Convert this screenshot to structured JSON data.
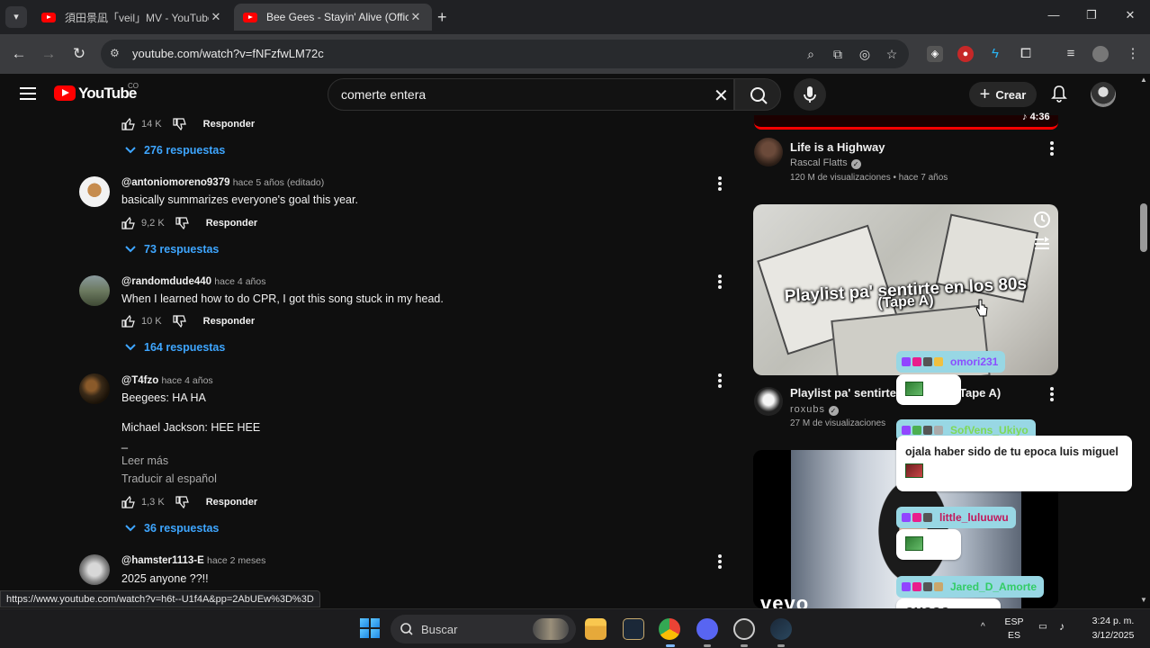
{
  "browser": {
    "tabs": [
      {
        "title": "須田景凪「veil」MV - YouTube",
        "active": false
      },
      {
        "title": "Bee Gees - Stayin' Alive (Official",
        "active": true
      }
    ],
    "url": "youtube.com/watch?v=fNFzfwLM72c",
    "status_link": "https://www.youtube.com/watch?v=h6t--U1f4A&pp=2AbUEw%3D%3D"
  },
  "youtube": {
    "logo_text": "YouTube",
    "country": "CO",
    "search_query": "comerte entera",
    "create_label": "Crear"
  },
  "comments": [
    {
      "likes": "14 K",
      "reply_label": "Responder",
      "replies": "276 respuestas"
    },
    {
      "author": "@antoniomoreno9379",
      "meta": "hace 5 años (editado)",
      "text": "basically summarizes everyone's goal this year.",
      "likes": "9,2 K",
      "reply_label": "Responder",
      "replies": "73 respuestas"
    },
    {
      "author": "@randomdude440",
      "meta": "hace 4 años",
      "text": "When I learned how to do CPR, I got this song stuck in my head.",
      "likes": "10 K",
      "reply_label": "Responder",
      "replies": "164 respuestas"
    },
    {
      "author": "@T4fzo",
      "meta": "hace 4 años",
      "lines": [
        "Beegees: HA HA",
        "Michael Jackson: HEE HEE",
        "_"
      ],
      "read_more": "Leer más",
      "translate": "Traducir al español",
      "likes": "1,3 K",
      "reply_label": "Responder",
      "replies": "36 respuestas"
    },
    {
      "author": "@hamster1113-E",
      "meta": "hace 2 meses",
      "text": "2025 anyone ??!!"
    }
  ],
  "related": [
    {
      "duration": "4:36",
      "title": "Life is a Highway",
      "channel": "Rascal Flatts",
      "views": "120 M de visualizaciones",
      "age": "hace 7 años"
    },
    {
      "thumb_line1": "Playlist pa' sentirte en los 80s",
      "thumb_line2": "(Tape A)",
      "title": "Playlist pa' sentirte",
      "title_tail": "Tape A)",
      "channel": "roxubs",
      "views": "27 M de visualizaciones"
    },
    {
      "thumb_brand": "vevo"
    }
  ],
  "chat": [
    {
      "user": "omori231",
      "color": "#8a4fff",
      "message": ""
    },
    {
      "user": "SofVens_Ukiyo",
      "color": "#7ed957",
      "message": "ojala haber sido de tu epoca luis miguel"
    },
    {
      "user": "little_luluuwu",
      "color": "#c2185b",
      "message": ""
    },
    {
      "user": "Jared_D_Amorte",
      "color": "#33cc66",
      "message": "OMGGG"
    }
  ],
  "taskbar": {
    "search_placeholder": "Buscar",
    "lang": "ESP",
    "lang_sub": "ES",
    "time": "3:24 p. m.",
    "date": "3/12/2025"
  },
  "colors": {
    "accent_blue": "#3ea6ff",
    "youtube_red": "#ff0000",
    "chat_tag": "#98d7e4"
  }
}
